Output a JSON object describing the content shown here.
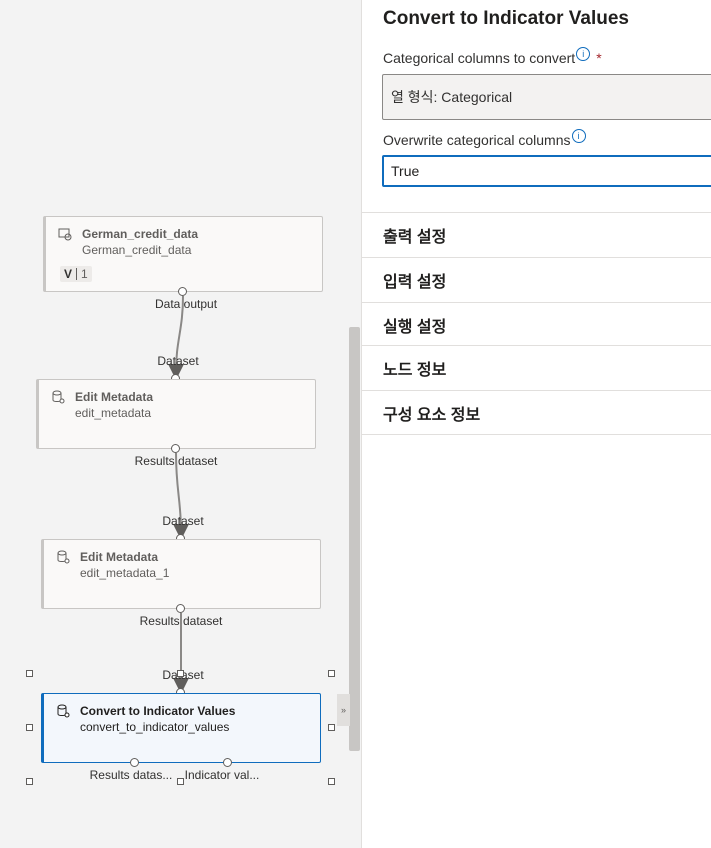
{
  "canvas": {
    "nodes": [
      {
        "id": "german",
        "title": "German_credit_data",
        "subtitle": "German_credit_data",
        "version_label": "V",
        "version": "1",
        "icon": "dataset-icon"
      },
      {
        "id": "edit1",
        "title": "Edit Metadata",
        "subtitle": "edit_metadata",
        "icon": "component-icon"
      },
      {
        "id": "edit2",
        "title": "Edit Metadata",
        "subtitle": "edit_metadata_1",
        "icon": "component-icon"
      },
      {
        "id": "convert",
        "title": "Convert to Indicator Values",
        "subtitle": "convert_to_indicator_values",
        "icon": "component-icon",
        "selected": true
      }
    ],
    "ports": {
      "german_out": "Data output",
      "edit1_in": "Dataset",
      "edit1_out": "Results dataset",
      "edit2_in": "Dataset",
      "edit2_out": "Results dataset",
      "convert_in": "Dataset",
      "convert_out1": "Results datas...",
      "convert_out2": "Indicator val..."
    },
    "collapse_glyph": "»"
  },
  "panel": {
    "title": "Convert to Indicator Values",
    "field1_label": "Categorical columns to convert",
    "field1_required": "*",
    "field1_value": "열 형식: Categorical",
    "field2_label": "Overwrite categorical columns",
    "field2_value": "True",
    "info_glyph": "i",
    "sections": [
      "출력 설정",
      "입력 설정",
      "실행 설정",
      "노드 정보",
      "구성 요소 정보"
    ]
  },
  "colors": {
    "accent": "#0f6cbd",
    "canvas_bg": "#f3f3f3",
    "panel_bg": "#ffffff"
  }
}
